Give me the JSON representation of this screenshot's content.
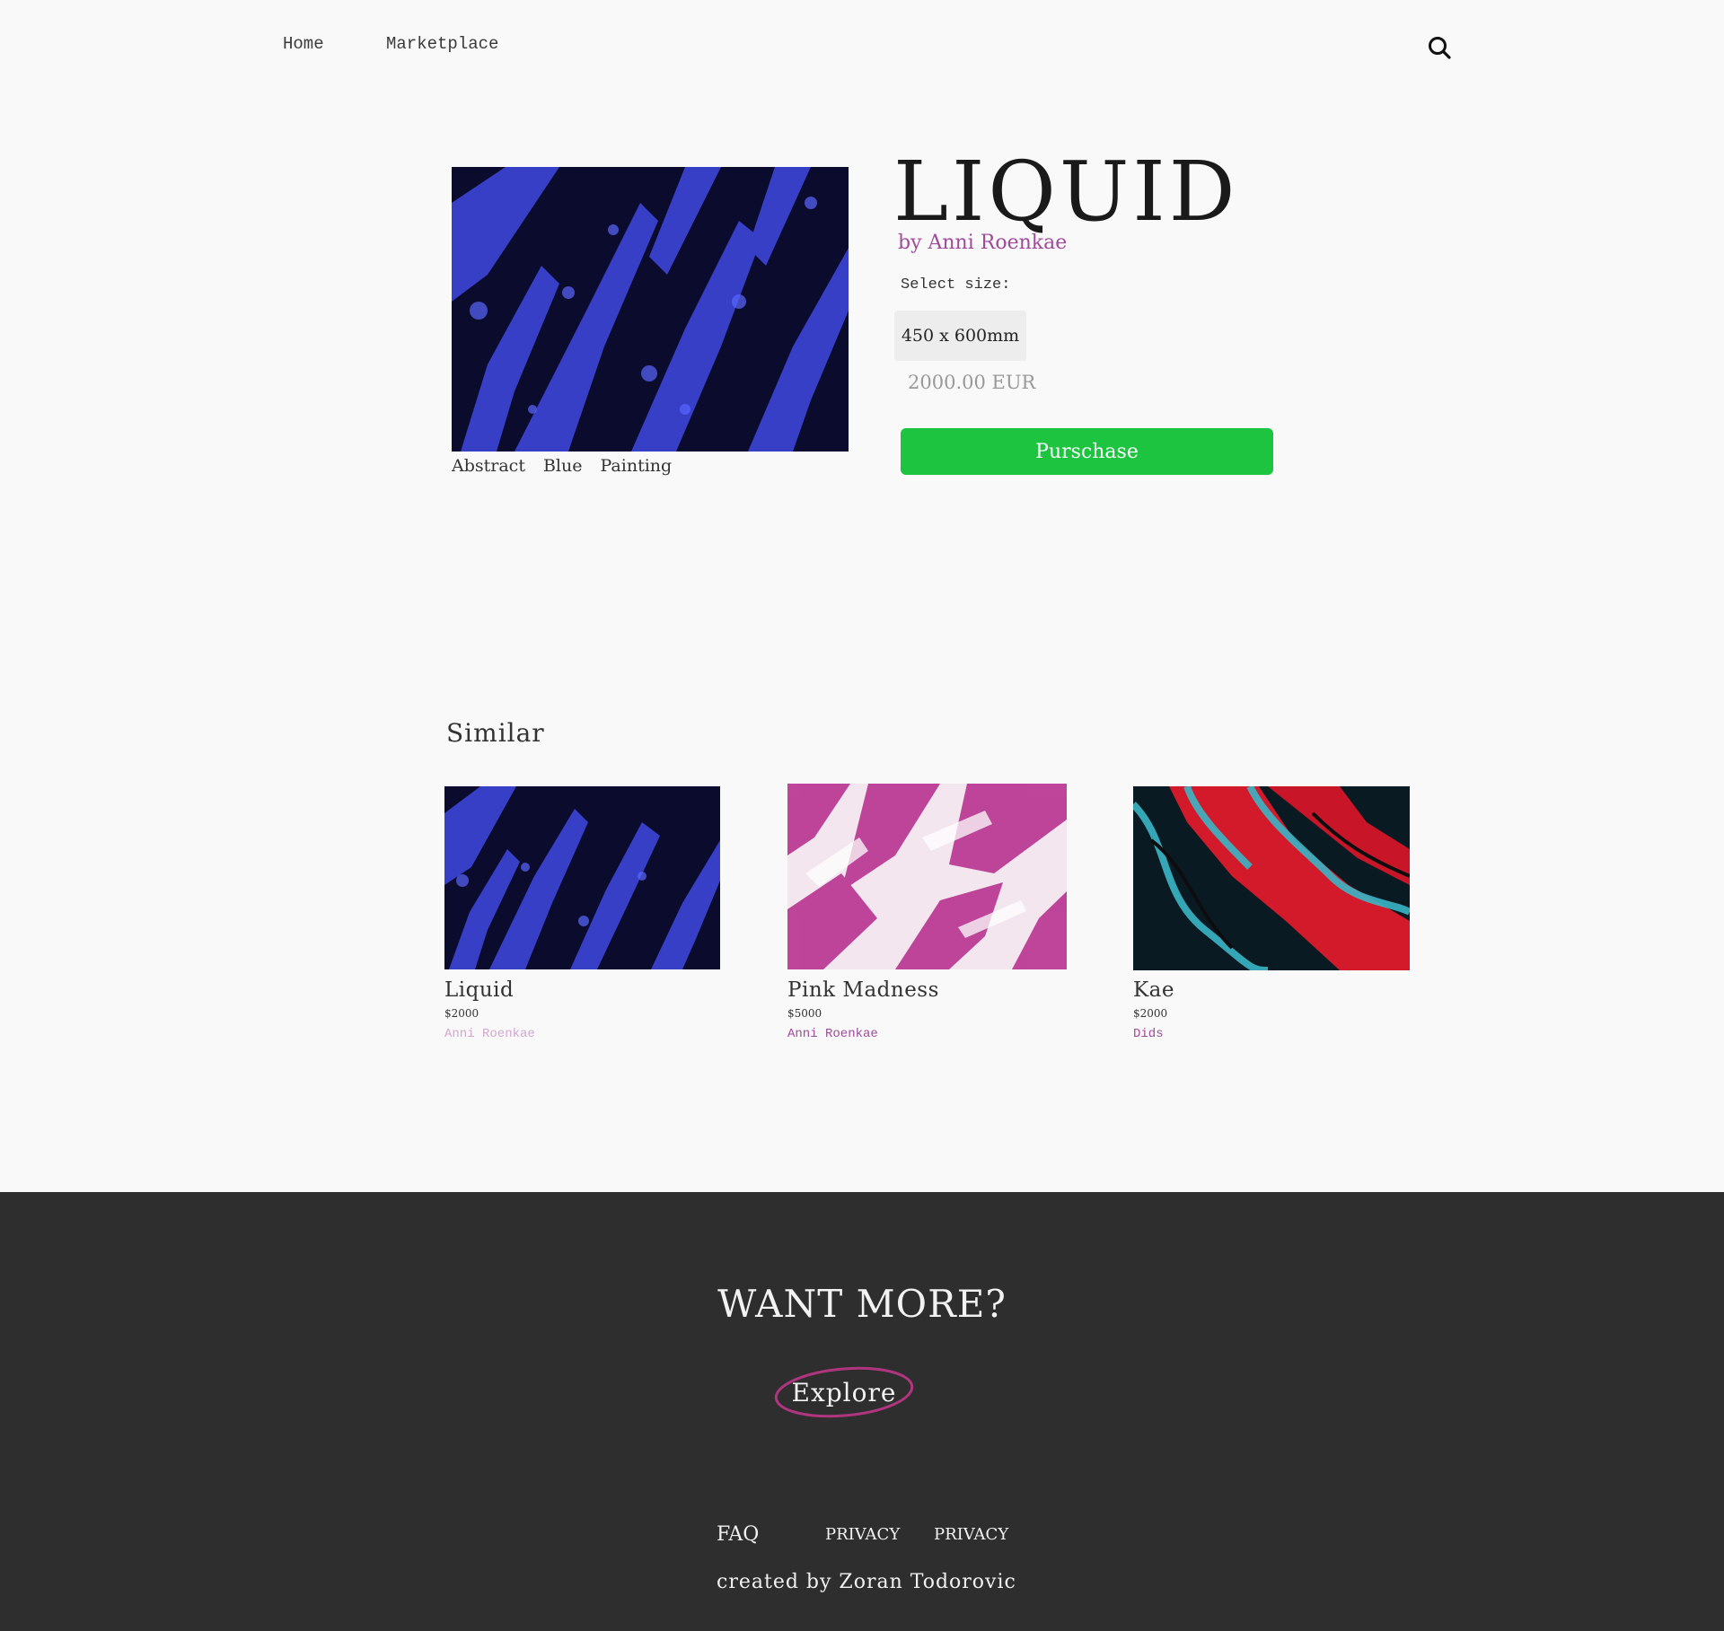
{
  "nav": {
    "home": "Home",
    "marketplace": "Marketplace",
    "search_icon": "search-icon"
  },
  "product": {
    "title": "LIQUID",
    "artist": "by Anni Roenkae",
    "size_label": "Select size:",
    "size_option": "450 x 600mm",
    "price": "2000.00 EUR",
    "purchase_label": "Purschase",
    "tags": [
      "Abstract",
      "Blue",
      "Painting"
    ]
  },
  "similar": {
    "heading": "Similar",
    "items": [
      {
        "title": "Liquid",
        "price": "$2000",
        "artist": "Anni Roenkae"
      },
      {
        "title": "Pink Madness",
        "price": "$5000",
        "artist": "Anni Roenkae"
      },
      {
        "title": "Kae",
        "price": "$2000",
        "artist": "Dids"
      }
    ]
  },
  "footer": {
    "heading": "WANT MORE?",
    "explore_label": "Explore",
    "faq": "FAQ",
    "privacy_1": "PRIVACY",
    "privacy_2": "PRIVACY",
    "credit": "created by Zoran Todorovic"
  },
  "colors": {
    "accent": "#a04a9c",
    "purchase": "#1cc440",
    "footer_bg": "#2e2e2e",
    "explore_ring": "#b0357f"
  }
}
